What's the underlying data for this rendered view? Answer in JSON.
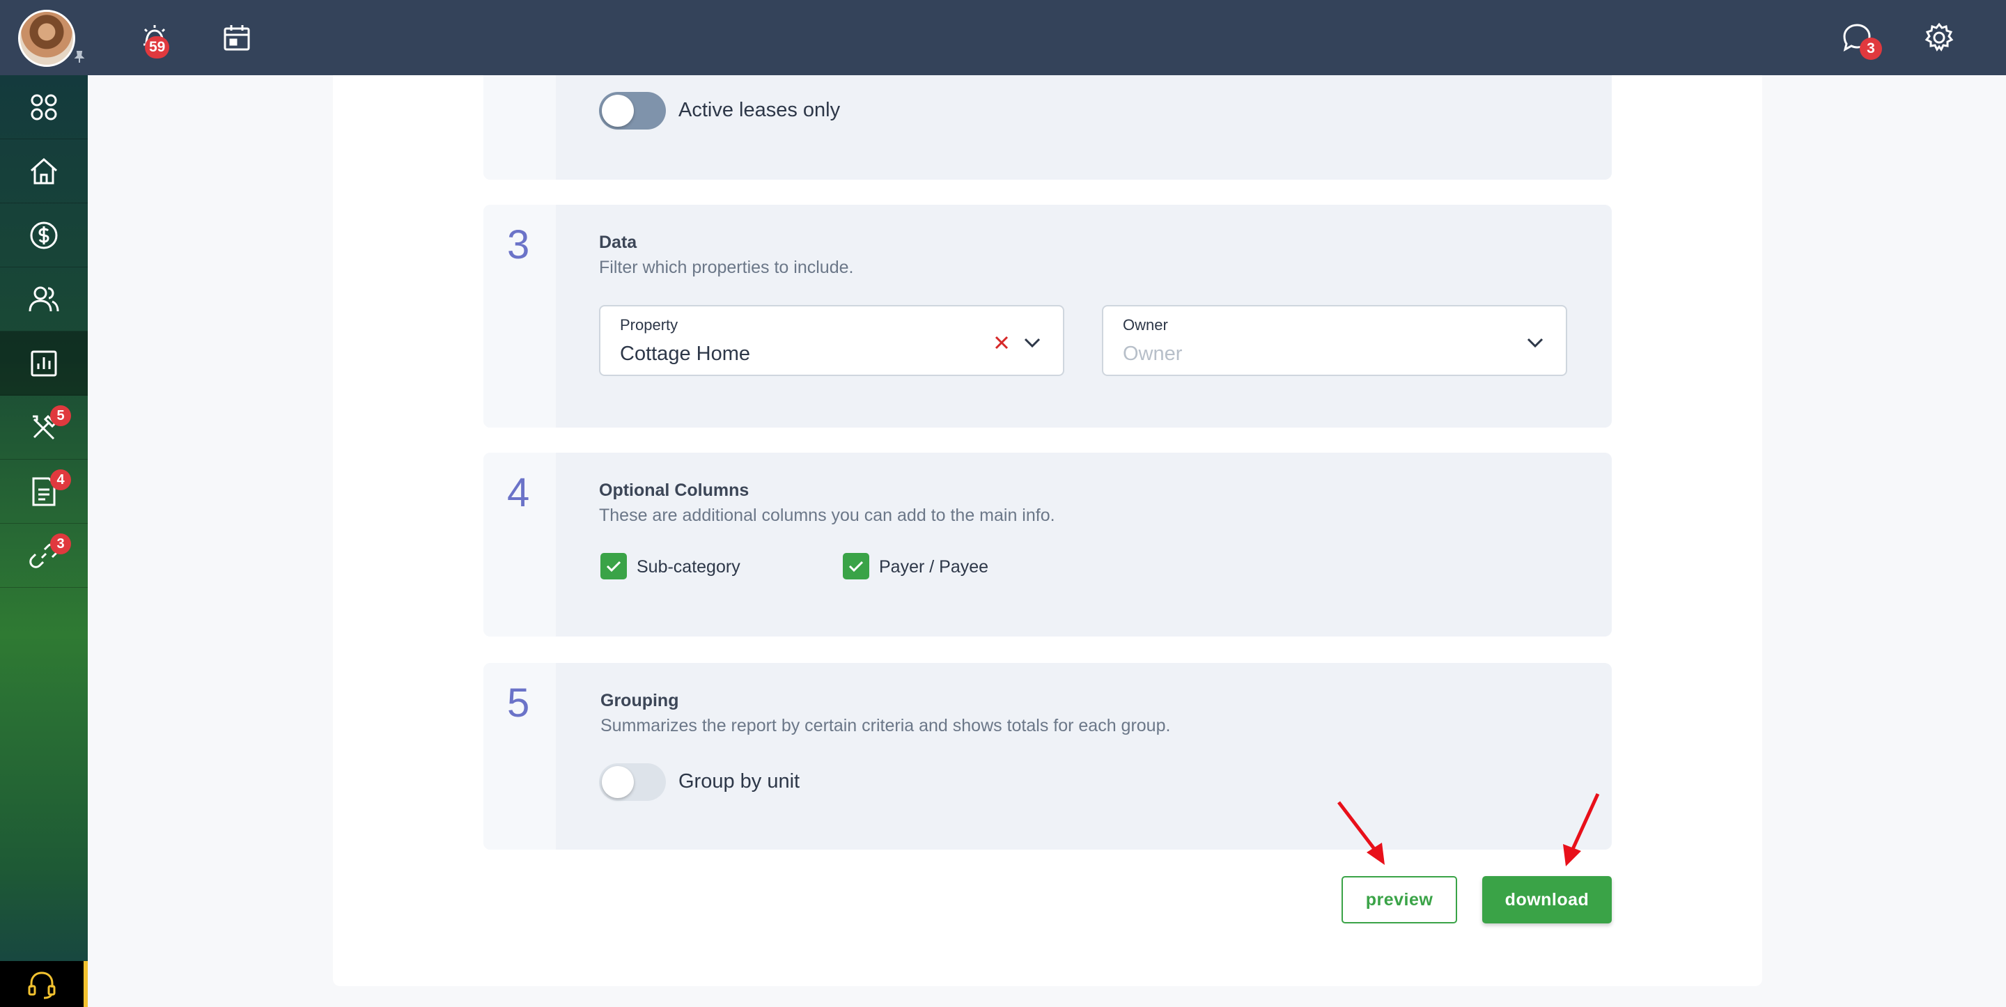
{
  "topbar": {
    "alerts_badge": "59",
    "messages_badge": "3"
  },
  "sidebar": {
    "items": [
      {
        "icon": "apps-grid-icon"
      },
      {
        "icon": "home-icon"
      },
      {
        "icon": "dollar-icon"
      },
      {
        "icon": "people-icon"
      },
      {
        "icon": "reports-chart-icon",
        "active": true
      },
      {
        "icon": "tools-icon",
        "badge": "5"
      },
      {
        "icon": "document-icon",
        "badge": "4"
      },
      {
        "icon": "link-icon",
        "badge": "3"
      }
    ]
  },
  "section2": {
    "toggle_label": "Active leases only",
    "toggle_on": true
  },
  "section3": {
    "number": "3",
    "title": "Data",
    "description": "Filter which properties to include.",
    "property": {
      "label": "Property",
      "value": "Cottage Home"
    },
    "owner": {
      "label": "Owner",
      "placeholder": "Owner"
    }
  },
  "section4": {
    "number": "4",
    "title": "Optional Columns",
    "description": "These are additional columns you can add to the main info.",
    "columns": [
      {
        "label": "Sub-category",
        "checked": true
      },
      {
        "label": "Payer / Payee",
        "checked": true
      }
    ]
  },
  "section5": {
    "number": "5",
    "title": "Grouping",
    "description": "Summarizes the report by certain criteria and shows totals for each group.",
    "toggle_label": "Group by unit",
    "toggle_on": false
  },
  "actions": {
    "preview_label": "preview",
    "download_label": "download"
  },
  "colors": {
    "accent_green": "#3aa347",
    "step_number": "#6b73c8",
    "badge_red": "#e0393e",
    "annotation_arrow": "#e8101a"
  }
}
